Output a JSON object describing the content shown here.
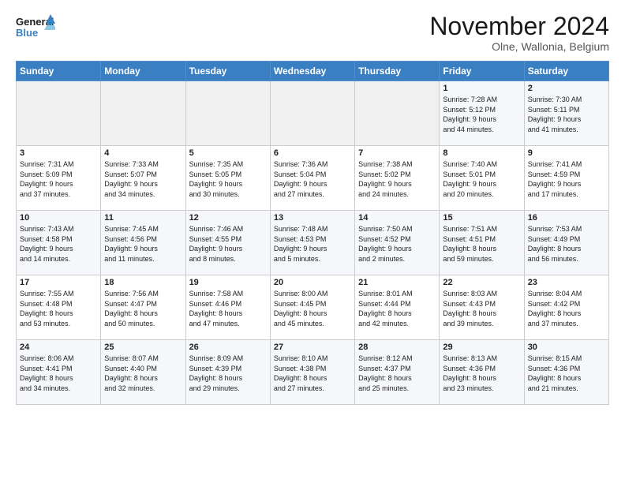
{
  "header": {
    "logo_line1": "General",
    "logo_line2": "Blue",
    "month_title": "November 2024",
    "location": "Olne, Wallonia, Belgium"
  },
  "weekdays": [
    "Sunday",
    "Monday",
    "Tuesday",
    "Wednesday",
    "Thursday",
    "Friday",
    "Saturday"
  ],
  "weeks": [
    [
      {
        "day": "",
        "info": ""
      },
      {
        "day": "",
        "info": ""
      },
      {
        "day": "",
        "info": ""
      },
      {
        "day": "",
        "info": ""
      },
      {
        "day": "",
        "info": ""
      },
      {
        "day": "1",
        "info": "Sunrise: 7:28 AM\nSunset: 5:12 PM\nDaylight: 9 hours\nand 44 minutes."
      },
      {
        "day": "2",
        "info": "Sunrise: 7:30 AM\nSunset: 5:11 PM\nDaylight: 9 hours\nand 41 minutes."
      }
    ],
    [
      {
        "day": "3",
        "info": "Sunrise: 7:31 AM\nSunset: 5:09 PM\nDaylight: 9 hours\nand 37 minutes."
      },
      {
        "day": "4",
        "info": "Sunrise: 7:33 AM\nSunset: 5:07 PM\nDaylight: 9 hours\nand 34 minutes."
      },
      {
        "day": "5",
        "info": "Sunrise: 7:35 AM\nSunset: 5:05 PM\nDaylight: 9 hours\nand 30 minutes."
      },
      {
        "day": "6",
        "info": "Sunrise: 7:36 AM\nSunset: 5:04 PM\nDaylight: 9 hours\nand 27 minutes."
      },
      {
        "day": "7",
        "info": "Sunrise: 7:38 AM\nSunset: 5:02 PM\nDaylight: 9 hours\nand 24 minutes."
      },
      {
        "day": "8",
        "info": "Sunrise: 7:40 AM\nSunset: 5:01 PM\nDaylight: 9 hours\nand 20 minutes."
      },
      {
        "day": "9",
        "info": "Sunrise: 7:41 AM\nSunset: 4:59 PM\nDaylight: 9 hours\nand 17 minutes."
      }
    ],
    [
      {
        "day": "10",
        "info": "Sunrise: 7:43 AM\nSunset: 4:58 PM\nDaylight: 9 hours\nand 14 minutes."
      },
      {
        "day": "11",
        "info": "Sunrise: 7:45 AM\nSunset: 4:56 PM\nDaylight: 9 hours\nand 11 minutes."
      },
      {
        "day": "12",
        "info": "Sunrise: 7:46 AM\nSunset: 4:55 PM\nDaylight: 9 hours\nand 8 minutes."
      },
      {
        "day": "13",
        "info": "Sunrise: 7:48 AM\nSunset: 4:53 PM\nDaylight: 9 hours\nand 5 minutes."
      },
      {
        "day": "14",
        "info": "Sunrise: 7:50 AM\nSunset: 4:52 PM\nDaylight: 9 hours\nand 2 minutes."
      },
      {
        "day": "15",
        "info": "Sunrise: 7:51 AM\nSunset: 4:51 PM\nDaylight: 8 hours\nand 59 minutes."
      },
      {
        "day": "16",
        "info": "Sunrise: 7:53 AM\nSunset: 4:49 PM\nDaylight: 8 hours\nand 56 minutes."
      }
    ],
    [
      {
        "day": "17",
        "info": "Sunrise: 7:55 AM\nSunset: 4:48 PM\nDaylight: 8 hours\nand 53 minutes."
      },
      {
        "day": "18",
        "info": "Sunrise: 7:56 AM\nSunset: 4:47 PM\nDaylight: 8 hours\nand 50 minutes."
      },
      {
        "day": "19",
        "info": "Sunrise: 7:58 AM\nSunset: 4:46 PM\nDaylight: 8 hours\nand 47 minutes."
      },
      {
        "day": "20",
        "info": "Sunrise: 8:00 AM\nSunset: 4:45 PM\nDaylight: 8 hours\nand 45 minutes."
      },
      {
        "day": "21",
        "info": "Sunrise: 8:01 AM\nSunset: 4:44 PM\nDaylight: 8 hours\nand 42 minutes."
      },
      {
        "day": "22",
        "info": "Sunrise: 8:03 AM\nSunset: 4:43 PM\nDaylight: 8 hours\nand 39 minutes."
      },
      {
        "day": "23",
        "info": "Sunrise: 8:04 AM\nSunset: 4:42 PM\nDaylight: 8 hours\nand 37 minutes."
      }
    ],
    [
      {
        "day": "24",
        "info": "Sunrise: 8:06 AM\nSunset: 4:41 PM\nDaylight: 8 hours\nand 34 minutes."
      },
      {
        "day": "25",
        "info": "Sunrise: 8:07 AM\nSunset: 4:40 PM\nDaylight: 8 hours\nand 32 minutes."
      },
      {
        "day": "26",
        "info": "Sunrise: 8:09 AM\nSunset: 4:39 PM\nDaylight: 8 hours\nand 29 minutes."
      },
      {
        "day": "27",
        "info": "Sunrise: 8:10 AM\nSunset: 4:38 PM\nDaylight: 8 hours\nand 27 minutes."
      },
      {
        "day": "28",
        "info": "Sunrise: 8:12 AM\nSunset: 4:37 PM\nDaylight: 8 hours\nand 25 minutes."
      },
      {
        "day": "29",
        "info": "Sunrise: 8:13 AM\nSunset: 4:36 PM\nDaylight: 8 hours\nand 23 minutes."
      },
      {
        "day": "30",
        "info": "Sunrise: 8:15 AM\nSunset: 4:36 PM\nDaylight: 8 hours\nand 21 minutes."
      }
    ]
  ]
}
